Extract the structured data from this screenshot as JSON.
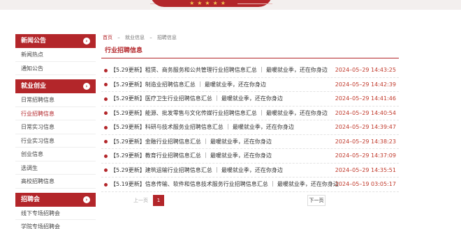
{
  "banner": {
    "stars": "★★★★★"
  },
  "sidebar": {
    "sections": [
      {
        "title": "新闻公告",
        "items": [
          "新闻热点",
          "通知公告"
        ]
      },
      {
        "title": "就业创业",
        "items": [
          "日常招聘信息",
          "行业招聘信息",
          "日常实习信息",
          "行业实习信息",
          "创业信息",
          "选调生",
          "高校招聘信息"
        ],
        "active": "行业招聘信息"
      },
      {
        "title": "招聘会",
        "items": [
          "线下专场招聘会",
          "学院专场招聘会"
        ]
      }
    ],
    "arrow_icon": "chevron-right-icon"
  },
  "breadcrumb": {
    "home": "首页",
    "sep": "–",
    "level1": "就业信息",
    "level2": "招聘信息"
  },
  "page_title": "行业招聘信息",
  "list": [
    {
      "title": "【5.29更新】租赁、商务服务和公共管理行业招聘信息汇总 ｜ 最暖就业季，还在你身边",
      "date": "2024–05–29 14:43:25"
    },
    {
      "title": "【5.29更新】制造业招聘信息汇总 ｜ 最暖就业季，还在你身边",
      "date": "2024–05–29 14:42:39"
    },
    {
      "title": "【5.29更新】医疗卫生行业招聘信息汇总 ｜ 最暖就业季，还在你身边",
      "date": "2024–05–29 14:41:46"
    },
    {
      "title": "【5.29更新】能源、批发零售与文化传媒行业招聘信息汇总 ｜ 最暖就业季，还在你身边",
      "date": "2024–05–29 14:40:54"
    },
    {
      "title": "【5.29更新】科研与技术服务业招聘信息汇总 ｜ 最暖就业季，还在你身边",
      "date": "2024–05–29 14:39:47"
    },
    {
      "title": "【5.29更新】金融行业招聘信息汇总 ｜ 最暖就业季，还在你身边",
      "date": "2024–05–29 14:38:23"
    },
    {
      "title": "【5.29更新】教育行业招聘信息汇总 ｜ 最暖就业季，还在你身边",
      "date": "2024–05–29 14:37:09"
    },
    {
      "title": "【5.29更新】建筑运输行业招聘信息汇总 ｜ 最暖就业季，还在你身边",
      "date": "2024–05–29 14:35:51"
    },
    {
      "title": "【5.19更新】信息传输、软件和信息技术服务行业招聘信息汇总 ｜ 最暖就业季，还在你身边",
      "date": "2024–05–19 03:05:17"
    }
  ],
  "pager": {
    "prev": "上一页",
    "current": "1",
    "next": "下一页"
  },
  "colors": {
    "accent": "#b3262a",
    "date": "#c0392b"
  }
}
